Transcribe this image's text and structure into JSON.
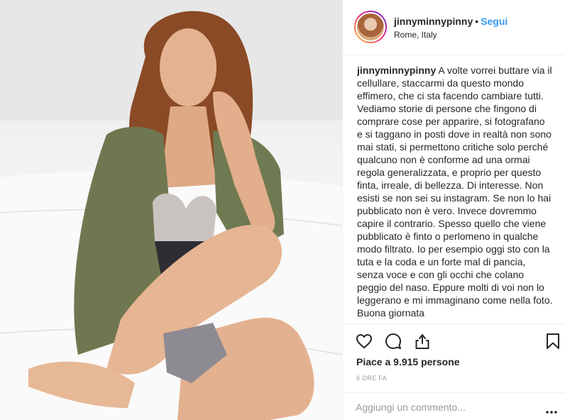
{
  "post": {
    "username": "jinnyminnypinny",
    "separator": "•",
    "follow_label": "Segui",
    "location": "Rome, Italy"
  },
  "caption": {
    "username": "jinnyminnypinny",
    "text": "A volte vorrei buttare via il cellullare, staccarmi da questo mondo effimero, che ci sta facendo cambiare tutti. Vediamo storie di persone che fingono di comprare cose per apparire, si fotografano e si taggano in posti dove in realtà non sono mai stati, si permettono critiche solo perché qualcuno non è conforme ad una ormai regola generalizzata, e proprio per questo finta, irreale, di bellezza. Di interesse. Non esisti se non sei su instagram. Se non lo hai pubblicato non è vero. Invece dovremmo capire il contrario. Spesso quello che viene pubblicato è finto o perlomeno in qualche modo filtrato. Io per esempio oggi sto con la tuta e la coda e un forte mal di pancia, senza voce e con gli occhi che colano peggio del naso. Eppure molti di voi non lo leggerano e mi immaginano come nella foto. Buona giornata"
  },
  "actions": {
    "icons": [
      "heart-icon",
      "comment-icon",
      "share-icon",
      "bookmark-icon"
    ],
    "likes_text": "Piace a 9.915 persone",
    "time_text": "6 ORE FA"
  },
  "comment": {
    "placeholder": "Aggiungi un commento...",
    "more_icon": "more-options-icon"
  },
  "colors": {
    "accent": "#3897f0",
    "text": "#262626",
    "muted": "#999999",
    "border": "#efefef"
  }
}
